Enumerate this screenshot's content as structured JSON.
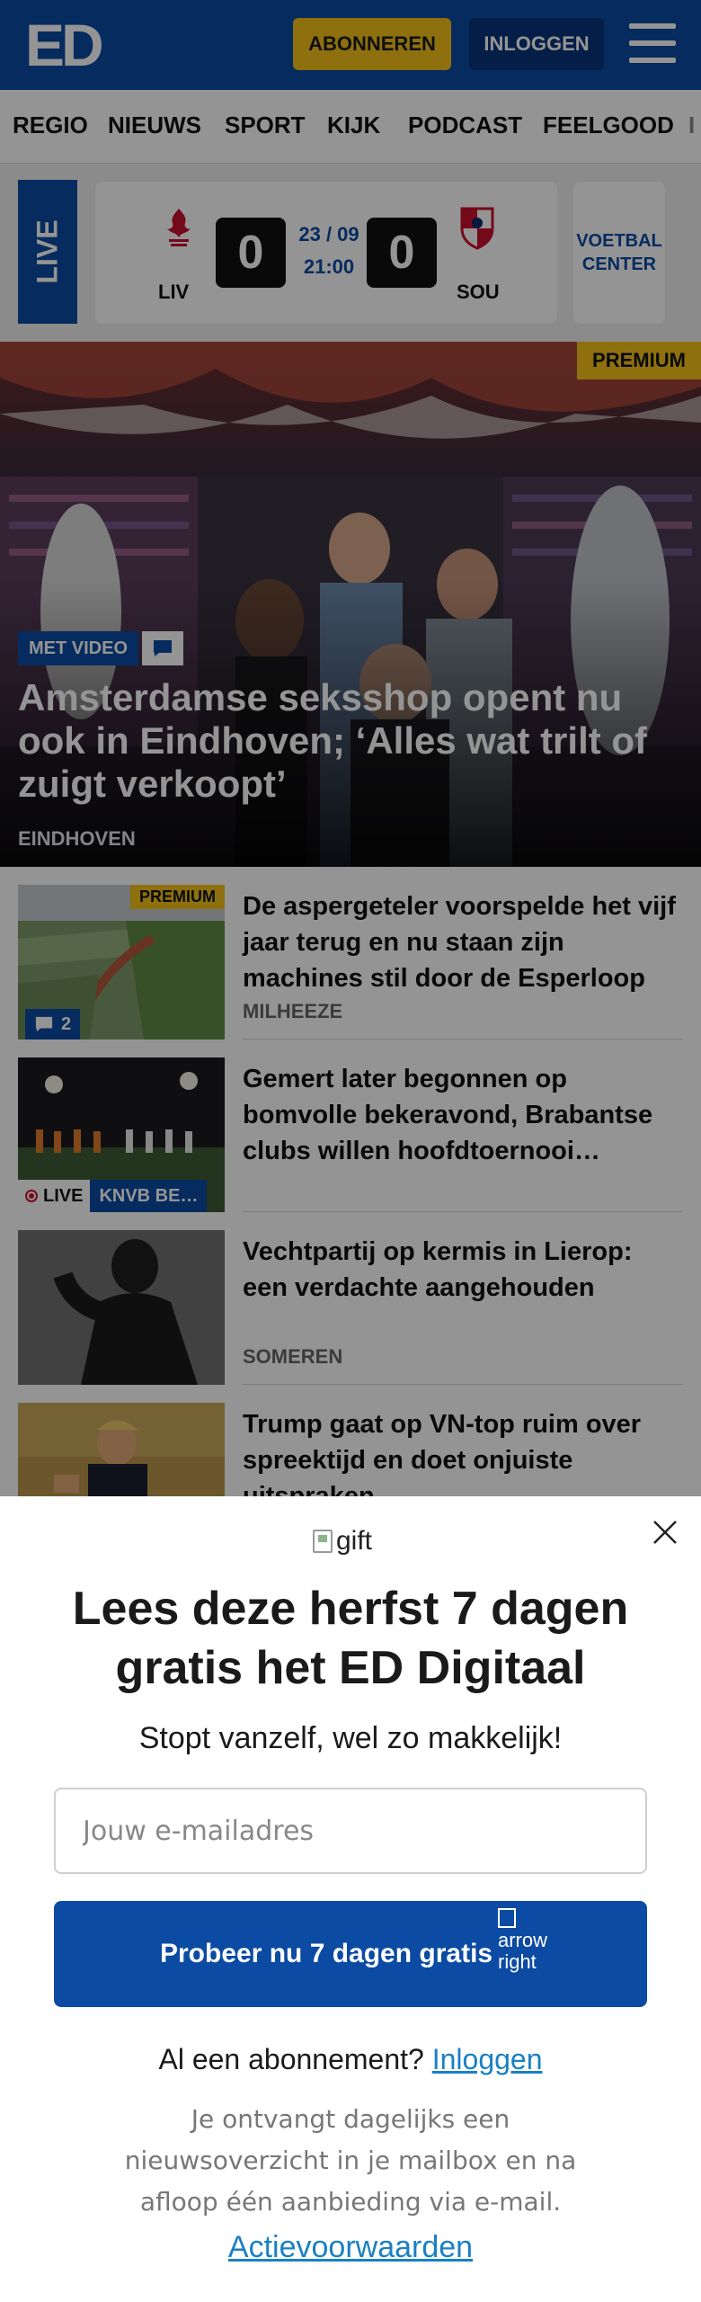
{
  "header": {
    "logo": "ED",
    "subscribe_label": "ABONNEREN",
    "login_label": "INLOGGEN"
  },
  "nav": {
    "items": [
      "REGIO",
      "NIEUWS",
      "SPORT",
      "KIJK",
      "PODCAST",
      "FEELGOOD",
      "I"
    ]
  },
  "live": {
    "tag": "LIVE",
    "home_team": "LIV",
    "away_team": "SOU",
    "home_score": "0",
    "away_score": "0",
    "date": "23 / 09",
    "time": "21:00",
    "center_line1": "VOETBAL",
    "center_line2": "CENTER"
  },
  "hero": {
    "premium": "PREMIUM",
    "video_tag": "MET VIDEO",
    "title": "Amsterdamse seksshop opent nu ook in Eindhoven; ‘Alles wat trilt of zuigt verkoopt’",
    "place": "EINDHOVEN"
  },
  "articles": [
    {
      "title": "De aspergeteler voorspelde het vijf jaar terug en nu staan zijn machines stil door de Esperloop",
      "place": "MILHEEZE",
      "premium": "PREMIUM",
      "comments": "2"
    },
    {
      "title": "Gemert later begonnen op bomvolle bekeravond, Brabantse clubs willen hoofdtoernooi…",
      "live": "LIVE",
      "category": "KNVB BE…"
    },
    {
      "title": "Vechtpartij op kermis in Lierop: een verdachte aangehouden",
      "place": "SOMEREN"
    },
    {
      "title": "Trump gaat op VN-top ruim over spreektijd en doet onjuiste uitspraken"
    }
  ],
  "modal": {
    "gift_alt": "gift",
    "title": "Lees deze herfst 7 dagen gratis het ED Digitaal",
    "subtitle": "Stopt vanzelf, wel zo makkelijk!",
    "email_placeholder": "Jouw e-mailadres",
    "cta_label": "Probeer nu 7 dagen gratis",
    "cta_icon_alt": "arrow right",
    "have_sub_prefix": "Al een abonnement?",
    "have_sub_link": "Inloggen",
    "info": "Je ontvangt dagelijks een nieuwsoverzicht in je mailbox en na afloop één aanbieding via e-mail.",
    "terms": "Actievoorwaarden"
  },
  "colors": {
    "brand_blue": "#0b4ba3",
    "premium_yellow": "#f5c21b",
    "link_blue": "#1a80c4"
  }
}
